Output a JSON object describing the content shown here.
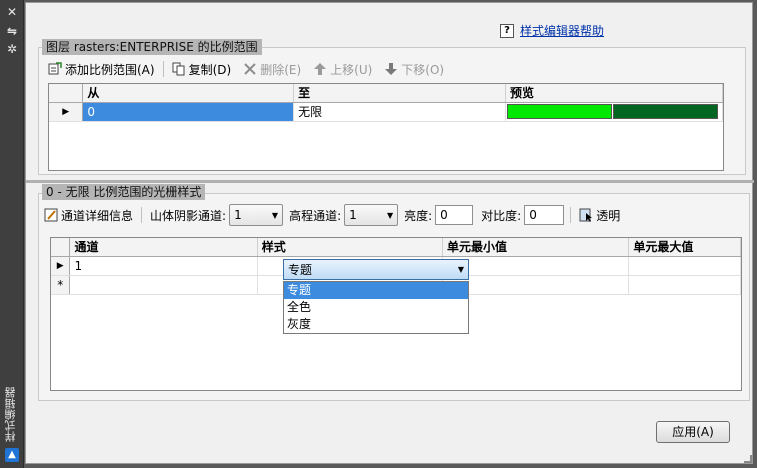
{
  "palette": {
    "title": "样式编辑器",
    "close_glyph": "✕",
    "autohide_glyph": "⇋",
    "props_glyph": "✲",
    "logo_glyph": "▲"
  },
  "help": {
    "qmark": "?",
    "label": "样式编辑器帮助"
  },
  "scale_section": {
    "title": "图层 rasters:ENTERPRISE 的比例范围",
    "toolbar": {
      "add_label": "添加比例范围(A)",
      "copy_label": "复制(D)",
      "delete_label": "删除(E)",
      "up_label": "上移(U)",
      "down_label": "下移(O)"
    },
    "columns": [
      "从",
      "至",
      "预览"
    ],
    "rows": [
      {
        "from": "0",
        "to": "无限",
        "preview_colors": [
          "#00e800",
          "#006622"
        ]
      }
    ]
  },
  "raster_section": {
    "title": "0 - 无限 比例范围的光栅样式",
    "toolbar": {
      "details_label": "通道详细信息",
      "hillshade_label": "山体阴影通道:",
      "hillshade_value": "1",
      "elevation_label": "高程通道:",
      "elevation_value": "1",
      "brightness_label": "亮度:",
      "brightness_value": "0",
      "contrast_label": "对比度:",
      "contrast_value": "0",
      "transparent_label": "透明"
    },
    "columns": [
      "通道",
      "样式",
      "单元最小值",
      "单元最大值"
    ],
    "rows": [
      {
        "channel": "1",
        "style": "专题"
      }
    ],
    "new_row_marker": "*",
    "style_options": [
      "专题",
      "全色",
      "灰度"
    ],
    "style_selected": "专题"
  },
  "apply_label": "应用(A)"
}
